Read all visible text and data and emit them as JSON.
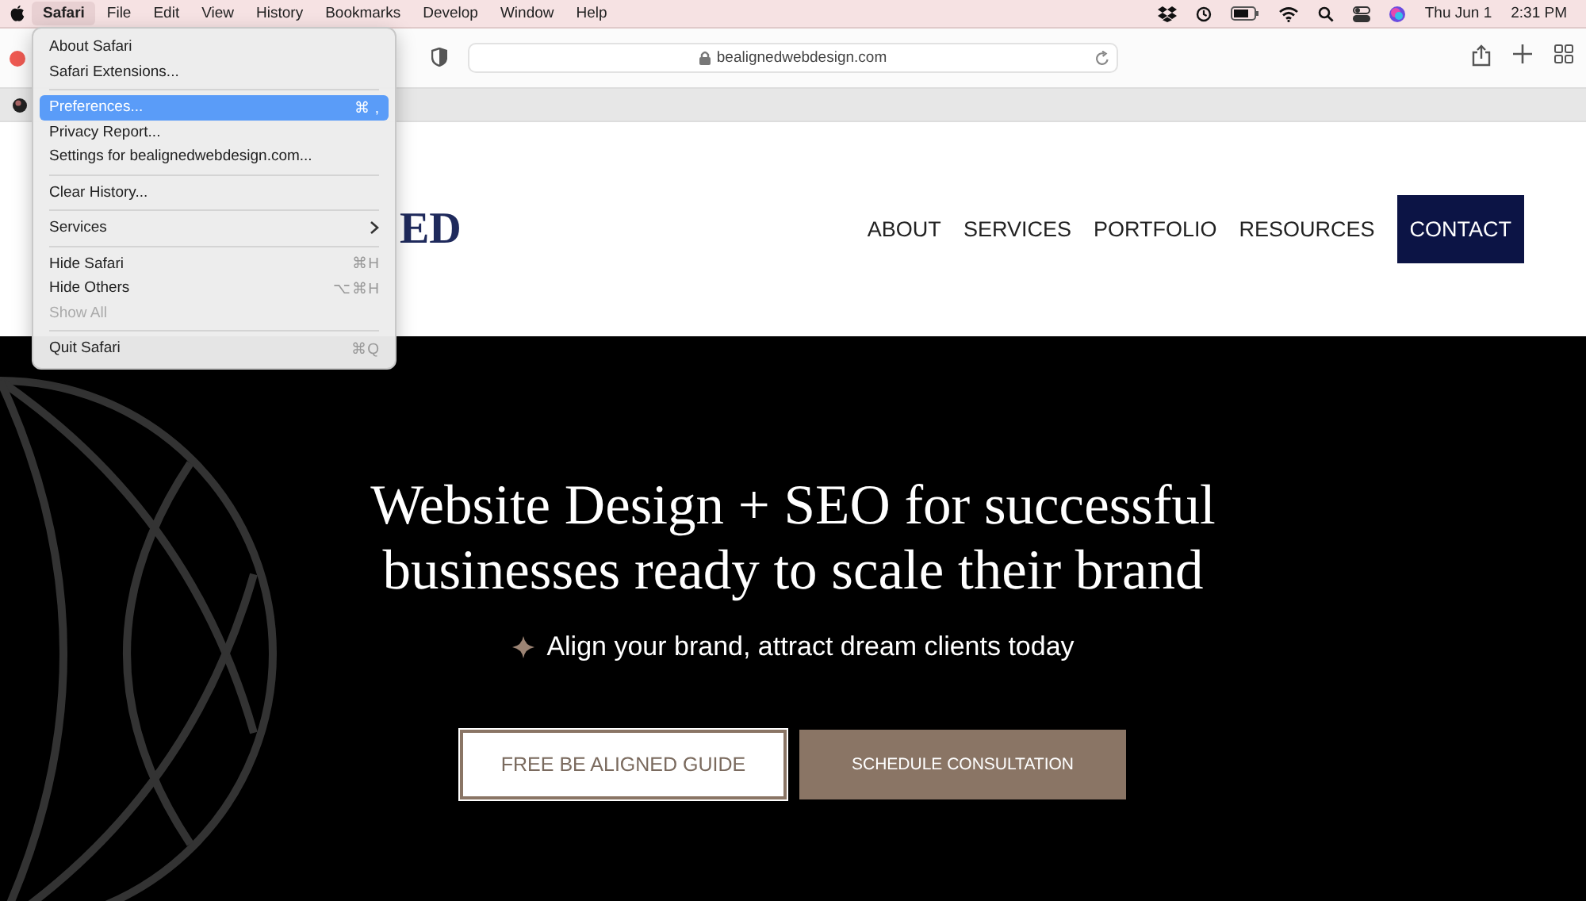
{
  "menu_bar": {
    "items": [
      {
        "label": "Safari",
        "selected": true
      },
      {
        "label": "File",
        "selected": false
      },
      {
        "label": "Edit",
        "selected": false
      },
      {
        "label": "View",
        "selected": false
      },
      {
        "label": "History",
        "selected": false
      },
      {
        "label": "Bookmarks",
        "selected": false
      },
      {
        "label": "Develop",
        "selected": false
      },
      {
        "label": "Window",
        "selected": false
      },
      {
        "label": "Help",
        "selected": false
      }
    ],
    "date": "Thu Jun 1",
    "time": "2:31 PM"
  },
  "toolbar": {
    "address": "bealignedwebdesign.com"
  },
  "menu": [
    {
      "kind": "item",
      "label": "About Safari",
      "selected": false,
      "disabled": false
    },
    {
      "kind": "item",
      "label": "Safari Extensions...",
      "selected": false,
      "disabled": false
    },
    {
      "kind": "separator"
    },
    {
      "kind": "item",
      "label": "Preferences...",
      "shortcut": "⌘ ,",
      "selected": true,
      "disabled": false
    },
    {
      "kind": "item",
      "label": "Privacy Report...",
      "selected": false,
      "disabled": false
    },
    {
      "kind": "item",
      "label": "Settings for bealignedwebdesign.com...",
      "selected": false,
      "disabled": false
    },
    {
      "kind": "separator"
    },
    {
      "kind": "item",
      "label": "Clear History...",
      "selected": false,
      "disabled": false
    },
    {
      "kind": "separator"
    },
    {
      "kind": "submenu",
      "label": "Services",
      "selected": false,
      "disabled": false
    },
    {
      "kind": "separator"
    },
    {
      "kind": "item",
      "label": "Hide Safari",
      "shortcut": "⌘H",
      "selected": false,
      "disabled": false
    },
    {
      "kind": "item",
      "label": "Hide Others",
      "shortcut": "⌥⌘H",
      "selected": false,
      "disabled": false
    },
    {
      "kind": "item",
      "label": "Show All",
      "selected": false,
      "disabled": true
    },
    {
      "kind": "separator"
    },
    {
      "kind": "item",
      "label": "Quit Safari",
      "shortcut": "⌘Q",
      "selected": false,
      "disabled": false
    }
  ],
  "site": {
    "logo": "ED",
    "nav": [
      {
        "label": "ABOUT",
        "kind": "link"
      },
      {
        "label": "SERVICES",
        "kind": "link"
      },
      {
        "label": "PORTFOLIO",
        "kind": "link"
      },
      {
        "label": "RESOURCES",
        "kind": "link"
      },
      {
        "label": "CONTACT",
        "kind": "button"
      }
    ],
    "hero": {
      "heading": [
        "Website Design + SEO for successful",
        "businesses ready to scale their brand"
      ],
      "subtitle": "Align your brand, attract dream clients today",
      "buttons": [
        {
          "label": "FREE BE ALIGNED GUIDE",
          "kind": "outline"
        },
        {
          "label": "SCHEDULE CONSULTATION",
          "kind": "filled"
        }
      ]
    }
  }
}
